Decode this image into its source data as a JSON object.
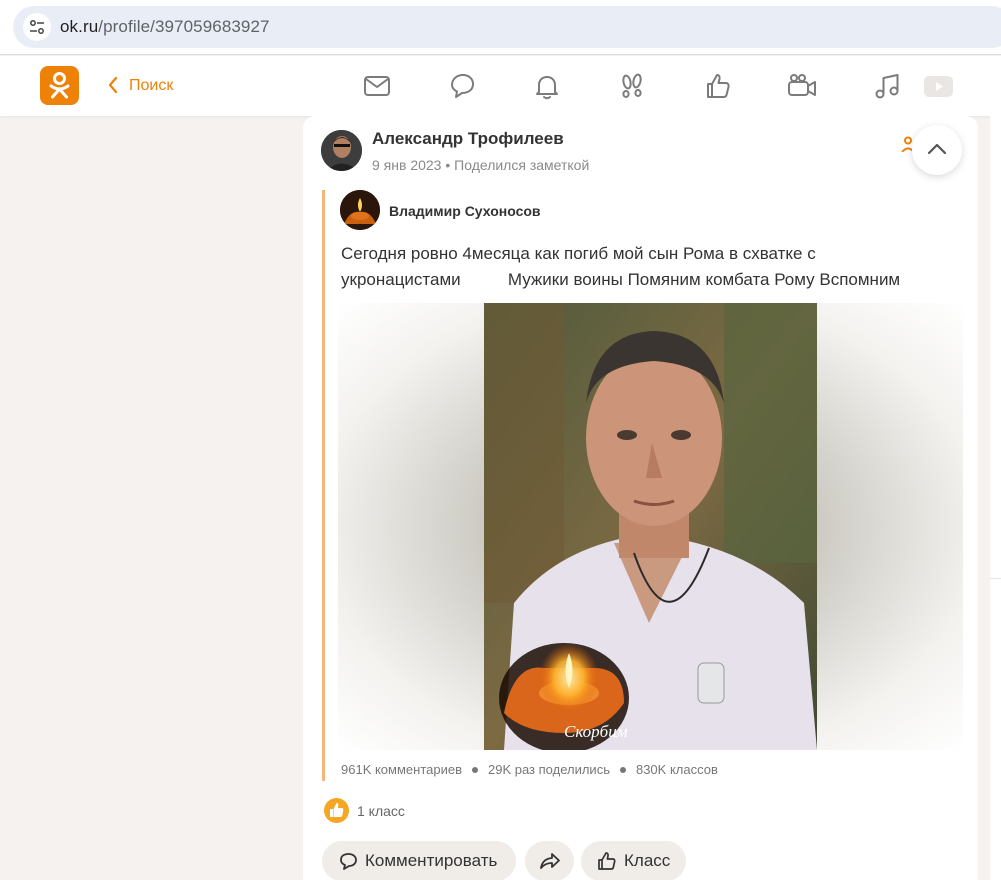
{
  "browser": {
    "url_host": "ok.ru",
    "url_path": "/profile/397059683927"
  },
  "topnav": {
    "back_label": "Поиск",
    "icons": [
      "ok-logo",
      "mail-icon",
      "chat-icon",
      "bell-icon",
      "guests-icon",
      "like-icon",
      "video-camera-icon",
      "music-icon",
      "video-play-icon"
    ]
  },
  "post": {
    "author": "Александр Трофилеев",
    "date": "9 янв 2023",
    "action": "Поделился заметкой",
    "repost": {
      "author": "Владимир Сухоносов",
      "text_line1": "Сегодня ровно 4месяца как погиб мой сын Рома в схватке с",
      "text_line2": "укронацистами          Мужики воины Помяним комбата Рому Вспомним",
      "photo_caption": "Скорбим",
      "stats": {
        "comments": "961K комментариев",
        "shares": "29K раз поделились",
        "klass": "830K классов"
      }
    },
    "likes_label": "1 класс",
    "actions": {
      "comment": "Комментировать",
      "klass": "Класс"
    }
  },
  "colors": {
    "accent": "#ee8208",
    "page_bg": "#f5f2ef",
    "repost_border": "#f3b57a",
    "like_badge": "#f5a623"
  }
}
